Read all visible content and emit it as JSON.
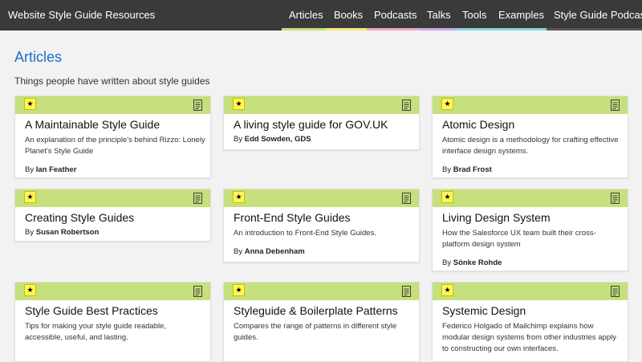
{
  "header": {
    "site_title": "Website Style Guide Resources",
    "nav": [
      {
        "label": "Articles"
      },
      {
        "label": "Books"
      },
      {
        "label": "Podcasts"
      },
      {
        "label": "Talks"
      },
      {
        "label": "Tools"
      },
      {
        "label": "Examples"
      },
      {
        "label": "Style Guide Podcast"
      }
    ],
    "stripe_colors": [
      "#c5e07c",
      "#f5e97a",
      "#f3a6c8",
      "#c9a7e8",
      "#8ad3e0",
      "#8ad3e0",
      "#555555"
    ]
  },
  "main": {
    "title": "Articles",
    "intro": "Things people have written about style guides"
  },
  "cards": [
    {
      "title": "A Maintainable Style Guide",
      "desc": "An explanation of the principle's behind Rizzo: Lonely Planet's Style Guide",
      "by": "By",
      "author": "Ian Feather"
    },
    {
      "title": "A living style guide for GOV.UK",
      "desc": "",
      "by": "By",
      "author": "Edd Sowden, GDS"
    },
    {
      "title": "Atomic Design",
      "desc": "Atomic design is a methodology for crafting effective interface design systems.",
      "by": "By",
      "author": "Brad Frost"
    },
    {
      "title": "Creating Style Guides",
      "desc": "",
      "by": "By",
      "author": "Susan Robertson"
    },
    {
      "title": "Front-End Style Guides",
      "desc": "An introduction to Front-End Style Guides.",
      "by": "By",
      "author": "Anna Debenham"
    },
    {
      "title": "Living Design System",
      "desc": "How the Salesforce UX team built their cross-platform design system",
      "by": "By",
      "author": "Sönke Rohde"
    },
    {
      "title": "Style Guide Best Practices",
      "desc": "Tips for making your style guide readable, accessible, useful, and lasting.",
      "by": "",
      "author": ""
    },
    {
      "title": "Styleguide & Boilerplate Patterns",
      "desc": "Compares the range of patterns in different style guides.",
      "by": "",
      "author": ""
    },
    {
      "title": "Systemic Design",
      "desc": "Federico Holgado of Mailchimp explains how modular design systems from other industries apply to constructing our own interfaces.",
      "by": "",
      "author": ""
    }
  ],
  "icons": {
    "star": "star-icon",
    "document": "document-icon"
  },
  "colors": {
    "card_bar": "#c5e07c",
    "star": "#fff65a",
    "link": "#1a6fc8",
    "header": "#3a3a3a"
  }
}
